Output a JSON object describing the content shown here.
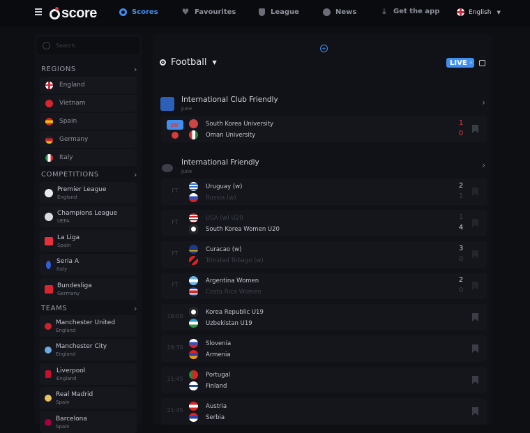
{
  "topbar": {
    "logo_text": "score",
    "nav": [
      {
        "label": "Scores",
        "icon": "scores-icon",
        "active": true
      },
      {
        "label": "Favourites",
        "icon": "heart-icon",
        "active": false
      },
      {
        "label": "League",
        "icon": "shield-icon",
        "active": false
      },
      {
        "label": "News",
        "icon": "news-icon",
        "active": false
      },
      {
        "label": "Get the app",
        "icon": "download-icon",
        "active": false
      }
    ],
    "language": "English"
  },
  "sidebar": {
    "search_placeholder": "Search",
    "regions_title": "REGIONS",
    "regions": [
      "England",
      "Vietnam",
      "Spain",
      "Germany",
      "Italy"
    ],
    "competitions_title": "COMPETITIONS",
    "competitions": [
      {
        "name": "Premier League",
        "sub": "England"
      },
      {
        "name": "Champions League",
        "sub": "UEFA"
      },
      {
        "name": "La Liga",
        "sub": "Spain"
      },
      {
        "name": "Seria A",
        "sub": "Italy"
      },
      {
        "name": "Bundesliga",
        "sub": "Germany"
      }
    ],
    "teams_title": "TEAMS",
    "teams": [
      {
        "name": "Manchester United",
        "sub": "England"
      },
      {
        "name": "Manchester City",
        "sub": "England"
      },
      {
        "name": "Liverpool",
        "sub": "England"
      },
      {
        "name": "Real Madrid",
        "sub": "Spain"
      },
      {
        "name": "Barcelona",
        "sub": "Spain"
      }
    ]
  },
  "main": {
    "sport": "Football",
    "live_label": "LIVE",
    "live_close": "×",
    "leagues": [
      {
        "name": "International Club Friendly",
        "date": "June",
        "matches": [
          {
            "time": "26'",
            "live": true,
            "home": "South Korea University",
            "away": "Oman University",
            "home_score": "1",
            "away_score": "0",
            "dim_home": false,
            "dim_away": false
          }
        ]
      },
      {
        "name": "International Friendly",
        "date": "June",
        "matches": [
          {
            "time": "FT",
            "live": false,
            "home": "Uruguay (w)",
            "away": "Russia (w)",
            "home_score": "2",
            "away_score": "1",
            "dim_home": false,
            "dim_away": true
          },
          {
            "time": "FT",
            "live": false,
            "home": "USA (w) U20",
            "away": "South Korea Women U20",
            "home_score": "1",
            "away_score": "4",
            "dim_home": true,
            "dim_away": false
          },
          {
            "time": "FT",
            "live": false,
            "home": "Curacao (w)",
            "away": "Trinidad Tobago (w)",
            "home_score": "3",
            "away_score": "0",
            "dim_home": false,
            "dim_away": true
          },
          {
            "time": "FT",
            "live": false,
            "home": "Argentina Women",
            "away": "Costa Rica Women",
            "home_score": "2",
            "away_score": "0",
            "dim_home": false,
            "dim_away": true
          },
          {
            "time": "18:00",
            "live": false,
            "home": "Korea Republic U19",
            "away": "Uzbekistan U19",
            "home_score": "",
            "away_score": "",
            "dim_home": false,
            "dim_away": false
          },
          {
            "time": "19:30",
            "live": false,
            "home": "Slovenia",
            "away": "Armenia",
            "home_score": "",
            "away_score": "",
            "dim_home": false,
            "dim_away": false
          },
          {
            "time": "21:45",
            "live": false,
            "home": "Portugal",
            "away": "Finland",
            "home_score": "",
            "away_score": "",
            "dim_home": false,
            "dim_away": false
          },
          {
            "time": "21:45",
            "live": false,
            "home": "Austria",
            "away": "Serbia",
            "home_score": "",
            "away_score": "",
            "dim_home": false,
            "dim_away": false
          }
        ]
      }
    ]
  }
}
